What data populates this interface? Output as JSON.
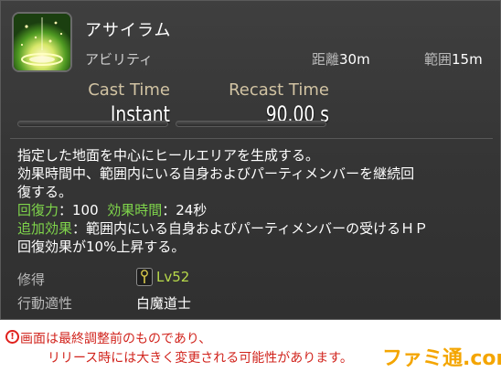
{
  "tooltip": {
    "icon": "asylum-ability-icon",
    "name": "アサイラム",
    "category": "アビリティ",
    "range_label": "距離",
    "range_value": "30m",
    "radius_label": "範囲",
    "radius_value": "15m",
    "cast_time_label": "Cast Time",
    "cast_time_value": "Instant",
    "recast_time_label": "Recast Time",
    "recast_time_value": "90.00 s",
    "description": {
      "line1": "指定した地面を中心にヒールエリアを生成する。",
      "line2": "効果時間中、範囲内にいる自身およびパーティメンバーを継続回",
      "line3": "復する。",
      "potency_label": "回復力",
      "potency_value": "：100",
      "duration_label": "効果時間",
      "duration_value": "：24秒",
      "additional_label": "追加効果",
      "additional_text": "：範囲内にいる自身およびパーティメンバーの受けるＨＰ",
      "line6": "回復効果が10%上昇する。"
    },
    "acquired_label": "修得",
    "acquired_level": "Lv52",
    "job_label": "行動適性",
    "job_value": "白魔道士"
  },
  "notice": {
    "icon": "exclamation-icon",
    "line1": "画面は最終調整前のものであり、",
    "line2": "リリース時には大きく変更される可能性があります。"
  },
  "watermark": "ファミ通.com",
  "colors": {
    "accent_green": "#7fd54b",
    "cast_label": "#d1c3a3",
    "level_yellow": "#b7d94a",
    "notice_red": "#d1241d",
    "watermark_orange": "#f4a500"
  }
}
